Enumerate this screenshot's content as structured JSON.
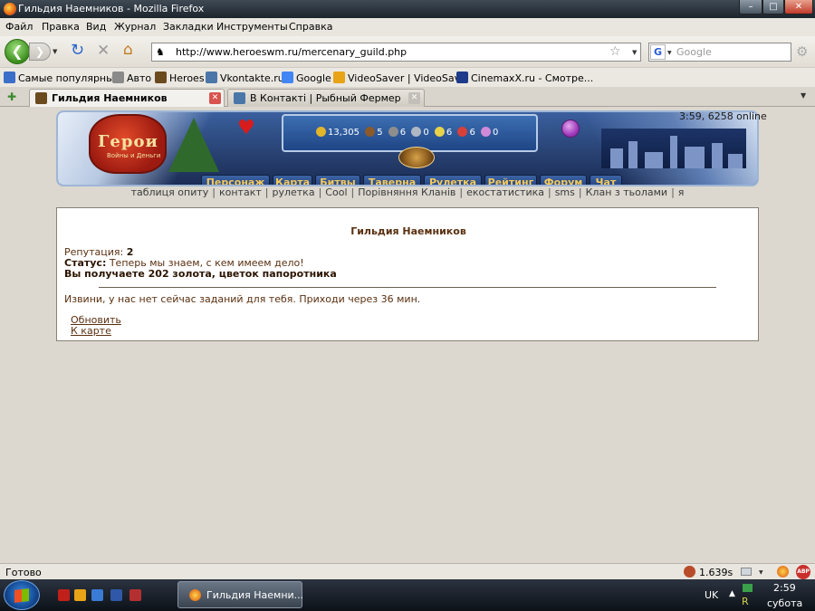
{
  "window": {
    "title": "Гильдия Наемников - Mozilla Firefox",
    "min": "–",
    "max": "□",
    "close": "✕"
  },
  "menu": [
    "Файл",
    "Правка",
    "Вид",
    "Журнал",
    "Закладки",
    "Инструменты",
    "Справка"
  ],
  "nav": {
    "url": "http://www.heroeswm.ru/mercenary_guild.php",
    "search_placeholder": "Google",
    "search_engine": "G"
  },
  "bookmarks": [
    {
      "label": "Самые популярные",
      "color": "#3b6fc9"
    },
    {
      "label": "Авто",
      "color": "#8a8a8a"
    },
    {
      "label": "Heroes",
      "color": "#6b4a1e"
    },
    {
      "label": "Vkontakte.ru",
      "color": "#4a76a8"
    },
    {
      "label": "Google",
      "color": "#4285f4"
    },
    {
      "label": "VideoSaver | VideoSav...",
      "color": "#e8a317"
    },
    {
      "label": "CinemaxX.ru - Смотре...",
      "color": "#1e3a8a"
    }
  ],
  "tabs": [
    {
      "label": "Гильдия Наемников",
      "active": true
    },
    {
      "label": "В Контакті | Рыбный Фермер",
      "active": false
    }
  ],
  "game": {
    "logo": "Герои",
    "logo_sub": "Войны и Деньги",
    "online": "3:59, 6258 online",
    "resources": [
      {
        "icon": "gold-icon",
        "value": "13,305",
        "color": "#e3b52a"
      },
      {
        "icon": "wood-icon",
        "value": "5",
        "color": "#8a5a2a"
      },
      {
        "icon": "ore-icon",
        "value": "6",
        "color": "#8e8e8e"
      },
      {
        "icon": "mercury-icon",
        "value": "0",
        "color": "#b0b7c4"
      },
      {
        "icon": "sulfur-icon",
        "value": "6",
        "color": "#e8d24a"
      },
      {
        "icon": "crystal-icon",
        "value": "6",
        "color": "#d9403a"
      },
      {
        "icon": "gems-icon",
        "value": "0",
        "color": "#d08ad8"
      }
    ],
    "nav": [
      "Персонаж",
      "Карта",
      "Битвы",
      "Таверна",
      "Рулетка",
      "Рейтинг",
      "Форум",
      "Чат"
    ],
    "sublinks": [
      "таблиця опиту",
      "контакт",
      "рулетка",
      "Cool",
      "Порівняння Кланів",
      "екостатистика",
      "sms",
      "Клан з тьолами",
      "я"
    ]
  },
  "guild": {
    "title": "Гильдия Наемников",
    "rep_label": "Репутация: ",
    "rep_value": "2",
    "status_label": "Статус:",
    "status_value": " Теперь мы знаем, с кем имеем дело!",
    "reward": "Вы получаете 202 золота, цветок папоротника",
    "no_tasks": "Извини, у нас нет сейчас заданий для тебя. Приходи через 36 мин.",
    "refresh": "Обновить",
    "to_map": "К карте"
  },
  "statusbar": {
    "text": "Готово",
    "timer": "1.639s",
    "abp": "ABP"
  },
  "taskbar": {
    "window": "Гильдия Наемни...",
    "lang": "UK",
    "time": "2:59",
    "day": "субота"
  }
}
